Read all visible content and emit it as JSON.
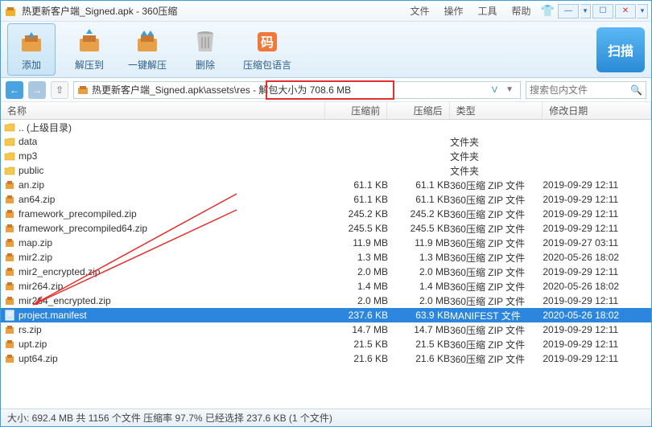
{
  "window": {
    "title": "热更新客户端_Signed.apk - 360压缩"
  },
  "menu": {
    "file": "文件",
    "operate": "操作",
    "tools": "工具",
    "help": "帮助"
  },
  "toolbar": {
    "add": "添加",
    "extract": "解压到",
    "onekey": "一键解压",
    "delete": "删除",
    "lang": "压缩包语言",
    "scan": "扫描"
  },
  "address": {
    "path": "热更新客户端_Signed.apk\\assets\\res - 解包大小为 708.6 MB",
    "search_placeholder": "搜索包内文件"
  },
  "columns": {
    "name": "名称",
    "before": "压缩前",
    "after": "压缩后",
    "type": "类型",
    "date": "修改日期"
  },
  "types": {
    "folder": "文件夹",
    "zip": "360压缩 ZIP 文件",
    "manifest": "MANIFEST 文件"
  },
  "rows": [
    {
      "icon": "folder",
      "name": ".. (上级目录)",
      "before": "",
      "after": "",
      "type": "",
      "date": ""
    },
    {
      "icon": "folder",
      "name": "data",
      "before": "",
      "after": "",
      "type": "folder",
      "date": ""
    },
    {
      "icon": "folder",
      "name": "mp3",
      "before": "",
      "after": "",
      "type": "folder",
      "date": ""
    },
    {
      "icon": "folder",
      "name": "public",
      "before": "",
      "after": "",
      "type": "folder",
      "date": ""
    },
    {
      "icon": "zip",
      "name": "an.zip",
      "before": "61.1 KB",
      "after": "61.1 KB",
      "type": "zip",
      "date": "2019-09-29 12:11"
    },
    {
      "icon": "zip",
      "name": "an64.zip",
      "before": "61.1 KB",
      "after": "61.1 KB",
      "type": "zip",
      "date": "2019-09-29 12:11"
    },
    {
      "icon": "zip",
      "name": "framework_precompiled.zip",
      "before": "245.2 KB",
      "after": "245.2 KB",
      "type": "zip",
      "date": "2019-09-29 12:11"
    },
    {
      "icon": "zip",
      "name": "framework_precompiled64.zip",
      "before": "245.5 KB",
      "after": "245.5 KB",
      "type": "zip",
      "date": "2019-09-29 12:11"
    },
    {
      "icon": "zip",
      "name": "map.zip",
      "before": "11.9 MB",
      "after": "11.9 MB",
      "type": "zip",
      "date": "2019-09-27 03:11"
    },
    {
      "icon": "zip",
      "name": "mir2.zip",
      "before": "1.3 MB",
      "after": "1.3 MB",
      "type": "zip",
      "date": "2020-05-26 18:02"
    },
    {
      "icon": "zip",
      "name": "mir2_encrypted.zip",
      "before": "2.0 MB",
      "after": "2.0 MB",
      "type": "zip",
      "date": "2019-09-29 12:11"
    },
    {
      "icon": "zip",
      "name": "mir264.zip",
      "before": "1.4 MB",
      "after": "1.4 MB",
      "type": "zip",
      "date": "2020-05-26 18:02"
    },
    {
      "icon": "zip",
      "name": "mir264_encrypted.zip",
      "before": "2.0 MB",
      "after": "2.0 MB",
      "type": "zip",
      "date": "2019-09-29 12:11"
    },
    {
      "icon": "file",
      "name": "project.manifest",
      "before": "237.6 KB",
      "after": "63.9 KB",
      "type": "manifest",
      "date": "2020-05-26 18:02",
      "selected": true
    },
    {
      "icon": "zip",
      "name": "rs.zip",
      "before": "14.7 MB",
      "after": "14.7 MB",
      "type": "zip",
      "date": "2019-09-29 12:11"
    },
    {
      "icon": "zip",
      "name": "upt.zip",
      "before": "21.5 KB",
      "after": "21.5 KB",
      "type": "zip",
      "date": "2019-09-29 12:11"
    },
    {
      "icon": "zip",
      "name": "upt64.zip",
      "before": "21.6 KB",
      "after": "21.6 KB",
      "type": "zip",
      "date": "2019-09-29 12:11"
    }
  ],
  "status": "大小: 692.4 MB 共 1156 个文件 压缩率 97.7% 已经选择 237.6 KB (1 个文件)"
}
